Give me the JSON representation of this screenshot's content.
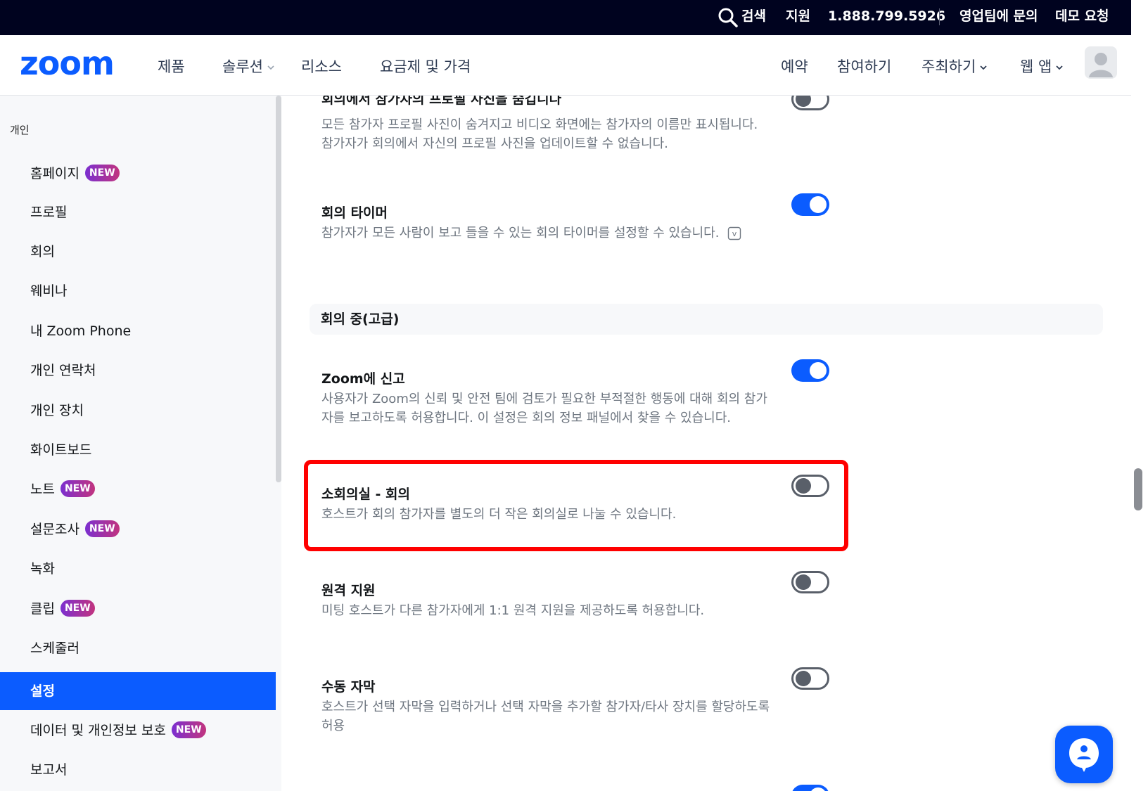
{
  "topbar": {
    "search": "검색",
    "support": "지원",
    "phone": "1.888.799.5926",
    "contact_sales": "영업팀에 문의",
    "request_demo": "데모 요청"
  },
  "header": {
    "logo": "zoom",
    "nav": [
      "제품",
      "솔루션",
      "리소스",
      "요금제 및 가격"
    ],
    "right": {
      "schedule": "예약",
      "join": "참여하기",
      "host": "주최하기",
      "web_app": "웹 앱"
    }
  },
  "sidebar": {
    "section": "개인",
    "items": [
      {
        "label": "홈페이지",
        "badge": "NEW"
      },
      {
        "label": "프로필",
        "badge": ""
      },
      {
        "label": "회의",
        "badge": ""
      },
      {
        "label": "웨비나",
        "badge": ""
      },
      {
        "label": "내 Zoom Phone",
        "badge": ""
      },
      {
        "label": "개인 연락처",
        "badge": ""
      },
      {
        "label": "개인 장치",
        "badge": ""
      },
      {
        "label": "화이트보드",
        "badge": ""
      },
      {
        "label": "노트",
        "badge": "NEW"
      },
      {
        "label": "설문조사",
        "badge": "NEW"
      },
      {
        "label": "녹화",
        "badge": ""
      },
      {
        "label": "클립",
        "badge": "NEW"
      },
      {
        "label": "스케줄러",
        "badge": ""
      },
      {
        "label": "설정",
        "badge": "",
        "active": true
      },
      {
        "label": "데이터 및 개인정보 보호",
        "badge": "NEW"
      },
      {
        "label": "보고서",
        "badge": ""
      }
    ]
  },
  "settings": {
    "hide_profile": {
      "title": "회의에서 참가자의 프로필 사진을 숨깁니다",
      "desc": "모든 참가자 프로필 사진이 숨겨지고 비디오 화면에는 참가자의 이름만 표시됩니다. 참가자가 회의에서 자신의 프로필 사진을 업데이트할 수 없습니다.",
      "enabled": false
    },
    "meeting_timer": {
      "title": "회의 타이머",
      "desc": "참가자가 모든 사람이 보고 들을 수 있는 회의 타이머를 설정할 수 있습니다.",
      "enabled": true
    },
    "section_advanced": "회의 중(고급)",
    "report_to_zoom": {
      "title": "Zoom에 신고",
      "desc": "사용자가 Zoom의 신뢰 및 안전 팀에 검토가 필요한 부적절한 행동에 대해 회의 참가자를 보고하도록 허용합니다. 이 설정은 회의 정보 패널에서 찾을 수 있습니다.",
      "enabled": true
    },
    "breakout_room": {
      "title": "소회의실 - 회의",
      "desc": "호스트가 회의 참가자를 별도의 더 작은 회의실로 나눌 수 있습니다.",
      "enabled": false
    },
    "remote_support": {
      "title": "원격 지원",
      "desc": "미팅 호스트가 다른 참가자에게 1:1 원격 지원을 제공하도록 허용합니다.",
      "enabled": false
    },
    "manual_captions": {
      "title": "수동 자막",
      "desc": "호스트가 선택 자막을 입력하거나 선택 자막을 추가할 참가자/타사 장치를 할당하도록 허용",
      "enabled": false
    }
  },
  "colors": {
    "accent": "#0b5cff",
    "topbar": "#00031f",
    "highlight": "#ff0000"
  }
}
